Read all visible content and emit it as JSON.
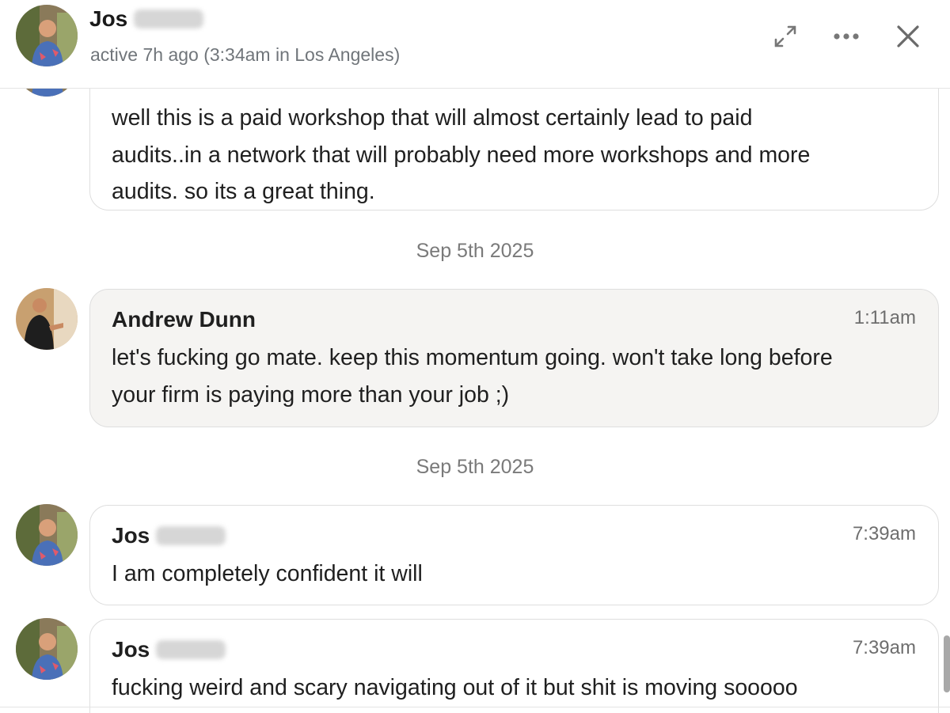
{
  "header": {
    "name": "Jos",
    "status": "active 7h ago (3:34am in Los Angeles)"
  },
  "messages": [
    {
      "text": "well this is a paid workshop that will almost certainly lead to paid\naudits..in a network that will probably need more workshops and more\naudits. so its a great thing."
    },
    {
      "date": "Sep 5th 2025",
      "sender": "Andrew Dunn",
      "time": "1:11am",
      "text": "let's fucking go mate. keep this momentum going. won't take long before\nyour firm is paying more than your job ;)"
    },
    {
      "date": "Sep 5th 2025",
      "sender": "Jos",
      "time": "7:39am",
      "text": "I am completely confident it will"
    },
    {
      "sender": "Jos",
      "time": "7:39am",
      "text": "fucking weird and scary navigating out of it but shit is moving sooooo"
    }
  ],
  "icons": [
    "expand-icon",
    "more-options-icon",
    "close-icon"
  ]
}
